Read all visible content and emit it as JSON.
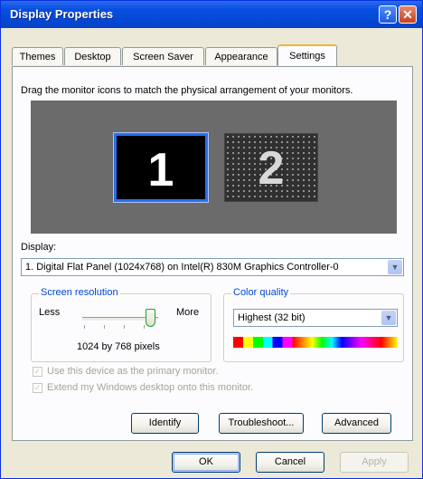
{
  "window": {
    "title": "Display Properties"
  },
  "title_buttons": {
    "help": "?",
    "close": "✕"
  },
  "tabs": [
    {
      "label": "Themes",
      "active": false
    },
    {
      "label": "Desktop",
      "active": false
    },
    {
      "label": "Screen Saver",
      "active": false
    },
    {
      "label": "Appearance",
      "active": false
    },
    {
      "label": "Settings",
      "active": true
    }
  ],
  "settings": {
    "instruction": "Drag the monitor icons to match the physical arrangement of your monitors.",
    "monitors": [
      {
        "number": "1",
        "selected": true
      },
      {
        "number": "2",
        "selected": false
      }
    ],
    "display_label": "Display:",
    "display_value": "1. Digital Flat Panel (1024x768) on Intel(R) 830M Graphics Controller-0",
    "screen_resolution": {
      "title": "Screen resolution",
      "less_label": "Less",
      "more_label": "More",
      "value_text": "1024 by 768 pixels",
      "slider_position": 0.85
    },
    "color_quality": {
      "title": "Color quality",
      "selected": "Highest (32 bit)"
    },
    "checkboxes": [
      {
        "label": "Use this device as the primary monitor.",
        "checked": true,
        "enabled": false
      },
      {
        "label": "Extend my Windows desktop onto this monitor.",
        "checked": true,
        "enabled": false
      }
    ],
    "buttons": {
      "identify": "Identify",
      "troubleshoot": "Troubleshoot...",
      "advanced": "Advanced"
    }
  },
  "dialog_buttons": {
    "ok": "OK",
    "cancel": "Cancel",
    "apply": "Apply"
  },
  "colors": {
    "titlebar": "#0a4fe0",
    "dialog_bg": "#ece9d8",
    "monitor_area": "#6b6b6b",
    "group_title": "#0046d5"
  },
  "icons": {
    "dropdown": "chevron-down-icon",
    "check": "checkmark-icon"
  }
}
